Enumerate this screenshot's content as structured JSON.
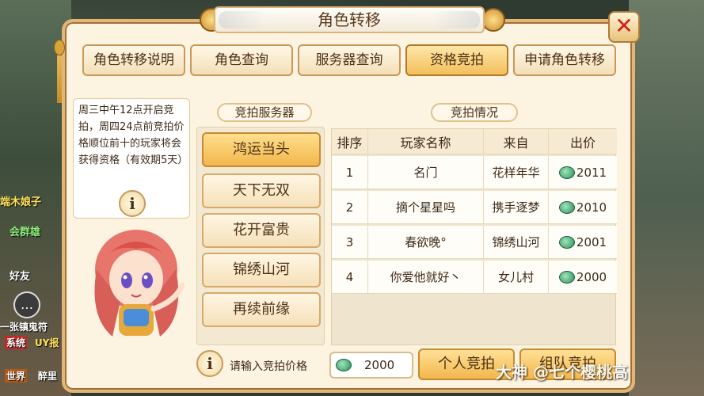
{
  "title": "角色转移",
  "close_label": "✕",
  "tabs": [
    {
      "label": "角色转移说明",
      "active": false
    },
    {
      "label": "角色查询",
      "active": false
    },
    {
      "label": "服务器查询",
      "active": false
    },
    {
      "label": "资格竞拍",
      "active": true
    },
    {
      "label": "申请角色转移",
      "active": false
    }
  ],
  "info_text": "周三中午12点开启竞拍，周四24点前竞拍价格顺位前十的玩家将会获得资格（有效期5天）",
  "info_icon": "i",
  "server_section_label": "竞拍服务器",
  "servers": [
    {
      "label": "鸿运当头",
      "active": true
    },
    {
      "label": "天下无双",
      "active": false
    },
    {
      "label": "花开富贵",
      "active": false
    },
    {
      "label": "锦绣山河",
      "active": false
    },
    {
      "label": "再续前缘",
      "active": false
    }
  ],
  "auction_section_label": "竞拍情况",
  "table": {
    "headers": [
      "排序",
      "玩家名称",
      "来自",
      "出价"
    ],
    "rows": [
      {
        "rank": "1",
        "name": "名门",
        "from": "花样年华",
        "bid": "2011"
      },
      {
        "rank": "2",
        "name": "摘个星星吗",
        "from": "携手逐梦",
        "bid": "2010"
      },
      {
        "rank": "3",
        "name": "春欲晚°",
        "from": "锦绣山河",
        "bid": "2001"
      },
      {
        "rank": "4",
        "name": "你爱他就好丶",
        "from": "女儿村",
        "bid": "2000"
      }
    ]
  },
  "bid_input_label": "请输入竞拍价格",
  "bid_input_value": "2000",
  "personal_bid_label": "个人竞拍",
  "team_bid_label": "组队竞拍",
  "watermark": "大神 @七个樱桃高",
  "side_texts": [
    "端木娘子",
    "会群雄",
    "好友",
    "一张镇鬼符",
    "系统",
    "UY报",
    "世界",
    "醉里"
  ],
  "icons": {
    "currency": "jade-coin-icon",
    "close": "close-icon",
    "info": "info-icon",
    "chat": "chat-icon"
  }
}
